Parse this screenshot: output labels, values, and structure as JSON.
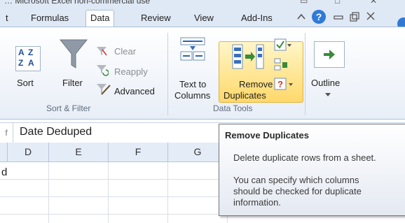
{
  "window": {
    "title": "… Microsoft Excel non-commercial use",
    "min_icon": "minimize-icon",
    "restore_icon": "restore-icon",
    "close_icon": "close-icon"
  },
  "tabs": [
    {
      "label": "t"
    },
    {
      "label": "Formulas"
    },
    {
      "label": "Data"
    },
    {
      "label": "Review"
    },
    {
      "label": "View"
    },
    {
      "label": "Add-Ins"
    }
  ],
  "active_tab": "Data",
  "ribbon": {
    "sort_filter": {
      "sort_label": "Sort",
      "filter_label": "Filter",
      "clear_label": "Clear",
      "reapply_label": "Reapply",
      "advanced_label": "Advanced",
      "group_label": "Sort & Filter"
    },
    "data_tools": {
      "text_to_columns_line1": "Text to",
      "text_to_columns_line2": "Columns",
      "remove_dup_line1": "Remove",
      "remove_dup_line2": "Duplicates",
      "group_label": "Data Tools"
    },
    "outline": {
      "label": "Outline"
    }
  },
  "formula_bar": {
    "fx_glyph": "f",
    "value": "Date Deduped"
  },
  "grid": {
    "columns": [
      "D",
      "E",
      "F",
      "G"
    ],
    "cell_d1": "d"
  },
  "tooltip": {
    "title": "Remove Duplicates",
    "line1": "Delete duplicate rows from a sheet.",
    "line2": "You can specify which columns",
    "line3": "should be checked for duplicate",
    "line4": "information."
  },
  "colors": {
    "ribbon_bg": "#e8eef7",
    "highlight": "#ffd86a",
    "tab_bar": "#dfe8f5"
  }
}
